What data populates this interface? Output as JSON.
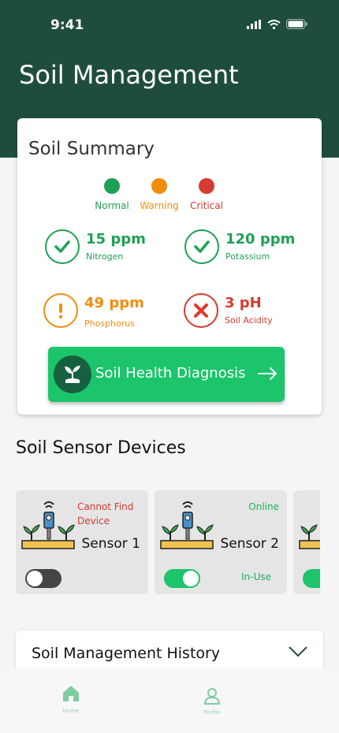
{
  "status_bar": {
    "time": "9:41",
    "icons": [
      "signal-icon",
      "wifi-icon",
      "battery-icon"
    ]
  },
  "header": {
    "title": "Soil Management"
  },
  "summary": {
    "title": "Soil Summary",
    "legend": [
      {
        "label": "Normal",
        "color": "#1ea154"
      },
      {
        "label": "Warning",
        "color": "#f28c0f"
      },
      {
        "label": "Critical",
        "color": "#d63b2f"
      }
    ],
    "metrics": [
      {
        "value": "15 ppm",
        "name": "Nitrogen",
        "status": "normal",
        "icon": "check-icon"
      },
      {
        "value": "120 ppm",
        "name": "Potassium",
        "status": "normal",
        "icon": "check-icon"
      },
      {
        "value": "49 ppm",
        "name": "Phosphorus",
        "status": "warning",
        "icon": "exclamation-icon"
      },
      {
        "value": "3 pH",
        "name": "Soil Acidity",
        "status": "critical",
        "icon": "x-icon"
      }
    ],
    "diagnosis_button": {
      "label": "Soil Health Diagnosis",
      "icon": "plant-icon"
    }
  },
  "devices": {
    "title": "Soil Sensor Devices",
    "items": [
      {
        "name": "Sensor 1",
        "status": "Cannot Find Device",
        "status_color": "#d63b2f",
        "enabled": false,
        "use_label": ""
      },
      {
        "name": "Sensor 2",
        "status": "Online",
        "status_color": "#1cb060",
        "enabled": true,
        "use_label": "In-Use"
      },
      {
        "name": "",
        "status": "",
        "status_color": "#1cb060",
        "enabled": true,
        "use_label": ""
      }
    ]
  },
  "history": {
    "title": "Soil Management History"
  },
  "nav": [
    {
      "label": "Home",
      "icon": "home-icon"
    },
    {
      "label": "Profile",
      "icon": "profile-icon"
    }
  ],
  "colors": {
    "header": "#1f4d3d",
    "accent": "#1cc46b",
    "normal": "#1ea154",
    "warning": "#f28c0f",
    "critical": "#d63b2f"
  }
}
